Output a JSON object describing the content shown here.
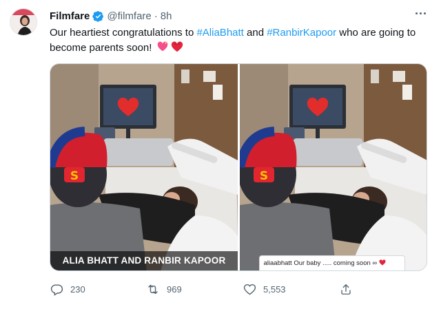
{
  "tweet": {
    "author_name": "Filmfare",
    "handle": "@filmfare",
    "separator": "·",
    "time": "8h",
    "text_before": "Our heartiest congratulations to ",
    "hashtag1": "#AliaBhatt",
    "text_middle": " and ",
    "hashtag2": "#RanbirKapoor",
    "text_after": " who are going to become parents soon! ",
    "hashtag_color": "#1d9bf0",
    "verified_color": "#1d9bf0"
  },
  "media": {
    "left_caption": "ALIA BHATT AND RANBIR KAPOOR",
    "right_ig_caption": "aliaabhatt Our baby ..... coming soon ∞"
  },
  "actions": {
    "reply_count": "230",
    "retweet_count": "969",
    "like_count": "5,553",
    "icons": [
      "reply-icon",
      "retweet-icon",
      "like-icon",
      "share-icon"
    ]
  }
}
